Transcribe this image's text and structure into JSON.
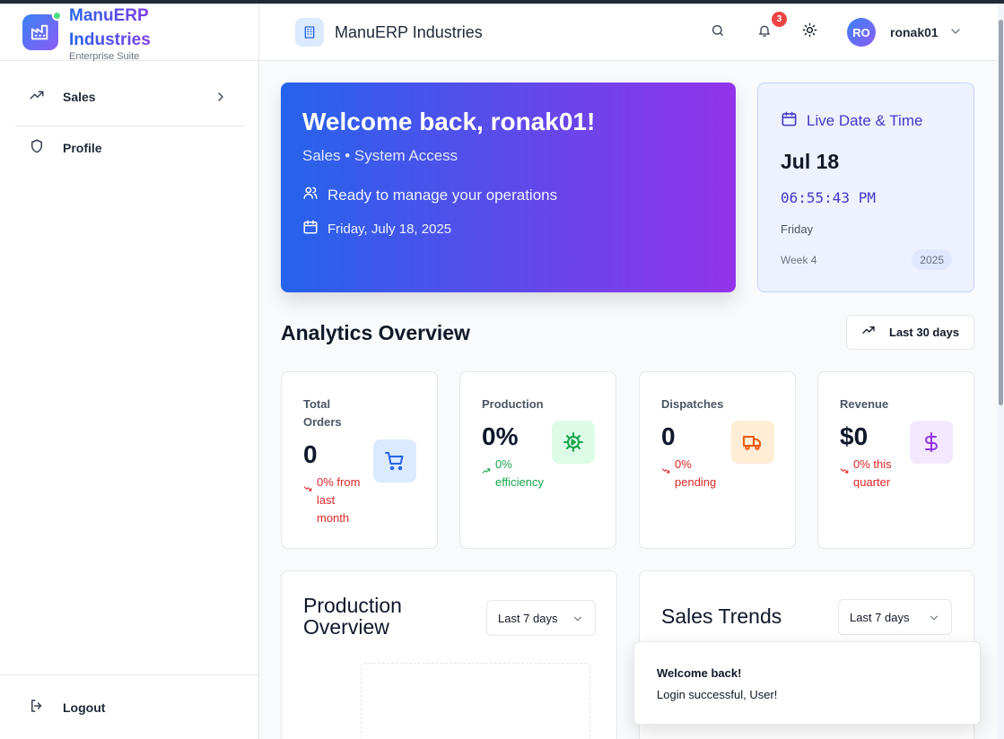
{
  "sidebar": {
    "brand_name": "ManuERP Industries",
    "brand_sub": "Enterprise Suite",
    "items": [
      {
        "label": "Sales",
        "icon": "trending-up-icon"
      },
      {
        "label": "Profile",
        "icon": "shield-icon"
      }
    ],
    "logout_label": "Logout"
  },
  "header": {
    "title": "ManuERP Industries",
    "notification_count": "3",
    "avatar_initials": "RO",
    "username": "ronak01"
  },
  "welcome": {
    "title": "Welcome back, ronak01!",
    "subtitle": "Sales • System Access",
    "tagline": "Ready to manage your operations",
    "date": "Friday, July 18, 2025"
  },
  "datetime": {
    "heading": "Live Date & Time",
    "date": "Jul 18",
    "time": "06:55:43 PM",
    "day": "Friday",
    "week": "Week 4",
    "year": "2025"
  },
  "analytics": {
    "title": "Analytics Overview",
    "range_label": "Last 30 days",
    "stats": [
      {
        "title": "Total Orders",
        "value": "0",
        "trend": "0% from last month",
        "trend_color": "#dc2626",
        "icon": "shopping-cart-icon",
        "accent": "#2563eb"
      },
      {
        "title": "Production",
        "value": "0%",
        "trend": "0% efficiency",
        "trend_color": "#16a34a",
        "icon": "cog-icon",
        "accent": "#16a34a"
      },
      {
        "title": "Dispatches",
        "value": "0",
        "trend": "0% pending",
        "trend_color": "#dc2626",
        "icon": "truck-icon",
        "accent": "#ea580c"
      },
      {
        "title": "Revenue",
        "value": "$0",
        "trend": "0% this quarter",
        "trend_color": "#dc2626",
        "icon": "dollar-icon",
        "accent": "#9333ea"
      }
    ]
  },
  "panels": {
    "production": {
      "title": "Production Overview",
      "range": "Last 7 days"
    },
    "sales": {
      "title": "Sales Trends",
      "range": "Last 7 days"
    }
  },
  "toast": {
    "title": "Welcome back!",
    "message": "Login successful, User!"
  }
}
